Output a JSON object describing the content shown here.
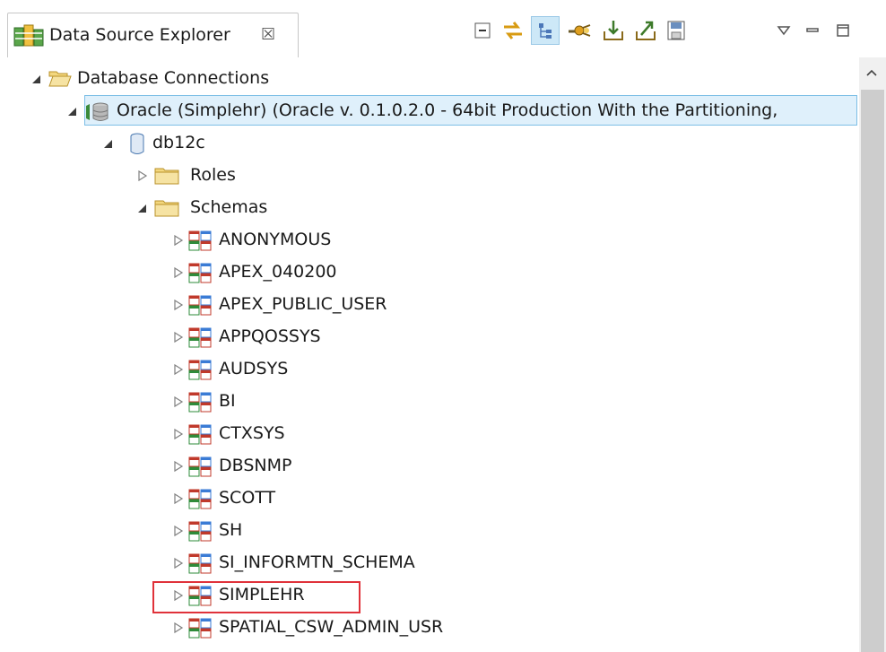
{
  "view": {
    "tab_title": "Data Source Explorer",
    "close_glyph": "☒"
  },
  "toolbar": {
    "buttons": [
      {
        "name": "collapse-all-icon"
      },
      {
        "name": "link-with-editor-icon"
      },
      {
        "name": "show-hierarchy-icon",
        "pressed": true
      },
      {
        "name": "new-connection-icon"
      },
      {
        "name": "import-icon"
      },
      {
        "name": "export-icon"
      },
      {
        "name": "save-icon"
      }
    ],
    "view_menu": "view-menu-icon",
    "minimize": "minimize-icon",
    "maximize": "maximize-icon"
  },
  "tree": {
    "root": "Database Connections",
    "connection": "Oracle (Simplehr) (Oracle v. 0.1.0.2.0 - 64bit Production With the Partitioning,",
    "database": "db12c",
    "roles": "Roles",
    "schemas_folder": "Schemas",
    "schemas": [
      "ANONYMOUS",
      "APEX_040200",
      "APEX_PUBLIC_USER",
      "APPQOSSYS",
      "AUDSYS",
      "BI",
      "CTXSYS",
      "DBSNMP",
      "SCOTT",
      "SH",
      "SI_INFORMTN_SCHEMA",
      "SIMPLEHR",
      "SPATIAL_CSW_ADMIN_USR"
    ],
    "highlighted_schema": "SIMPLEHR"
  },
  "colors": {
    "selection_border": "#7dbfe6",
    "selection_fill": "#dff0fb",
    "highlight": "#e0323a",
    "folder": "#f3d77e"
  }
}
